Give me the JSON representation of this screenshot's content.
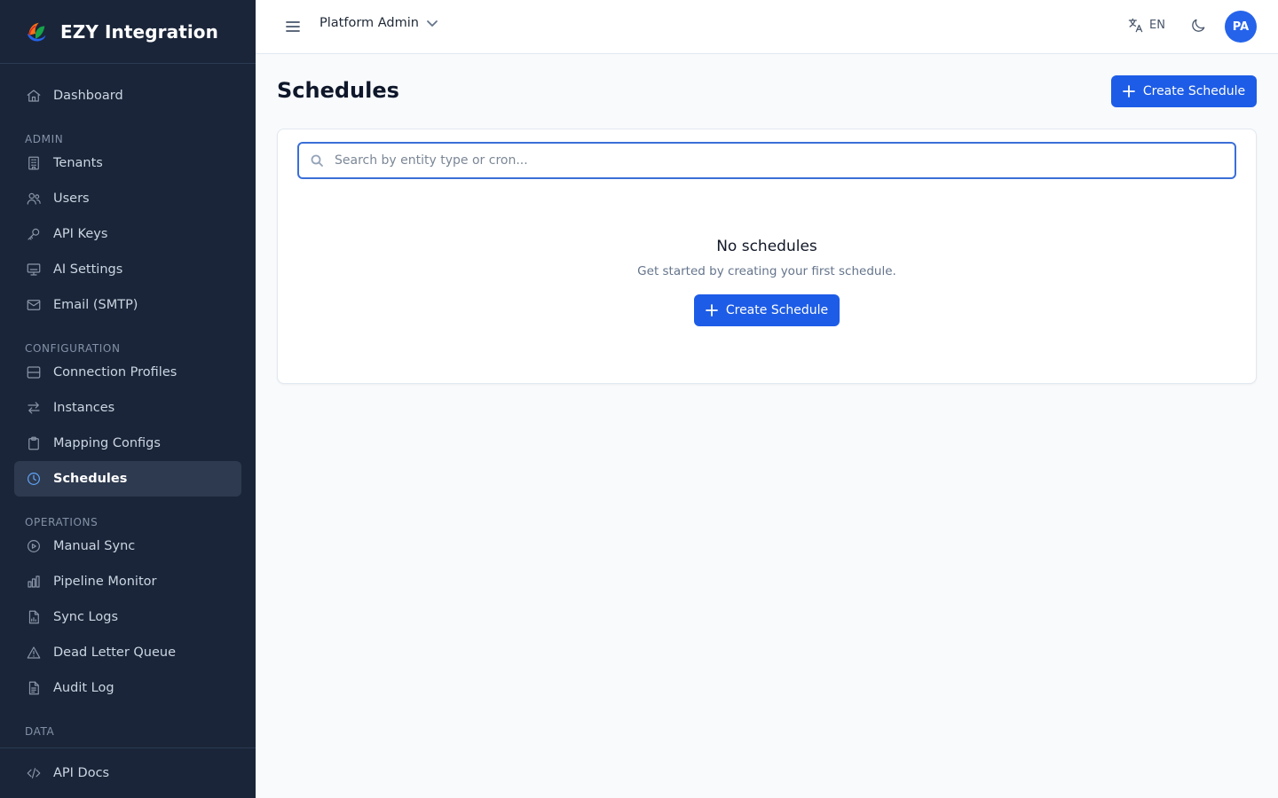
{
  "app": {
    "name": "EZY Integration"
  },
  "sidebar": {
    "top": [
      {
        "label": "Dashboard",
        "icon": "home-icon"
      }
    ],
    "sections": [
      {
        "label": "ADMIN",
        "items": [
          {
            "label": "Tenants",
            "icon": "building-icon"
          },
          {
            "label": "Users",
            "icon": "users-icon"
          },
          {
            "label": "API Keys",
            "icon": "key-icon"
          },
          {
            "label": "AI Settings",
            "icon": "monitor-icon"
          },
          {
            "label": "Email (SMTP)",
            "icon": "mail-icon"
          }
        ]
      },
      {
        "label": "CONFIGURATION",
        "items": [
          {
            "label": "Connection Profiles",
            "icon": "server-icon"
          },
          {
            "label": "Instances",
            "icon": "arrows-icon"
          },
          {
            "label": "Mapping Configs",
            "icon": "clipboard-icon"
          },
          {
            "label": "Schedules",
            "icon": "clock-icon",
            "active": true
          }
        ]
      },
      {
        "label": "OPERATIONS",
        "items": [
          {
            "label": "Manual Sync",
            "icon": "play-circle-icon"
          },
          {
            "label": "Pipeline Monitor",
            "icon": "bar-chart-icon"
          },
          {
            "label": "Sync Logs",
            "icon": "file-chart-icon"
          },
          {
            "label": "Dead Letter Queue",
            "icon": "warning-icon"
          },
          {
            "label": "Audit Log",
            "icon": "file-text-icon"
          }
        ]
      },
      {
        "label": "DATA",
        "items": []
      }
    ],
    "footer": {
      "label": "API Docs",
      "icon": "code-icon"
    }
  },
  "header": {
    "tenant": "Platform Admin",
    "language": "EN",
    "avatar_initials": "PA"
  },
  "main": {
    "title": "Schedules",
    "create_label": "Create Schedule",
    "search": {
      "placeholder": "Search by entity type or cron...",
      "value": ""
    },
    "empty": {
      "title": "No schedules",
      "subtitle": "Get started by creating your first schedule.",
      "button_label": "Create Schedule"
    }
  },
  "colors": {
    "sidebar_bg": "#1a2539",
    "primary": "#1d5ce6",
    "active_item_bg": "#2e3a4f",
    "active_icon": "#60a5fa"
  }
}
